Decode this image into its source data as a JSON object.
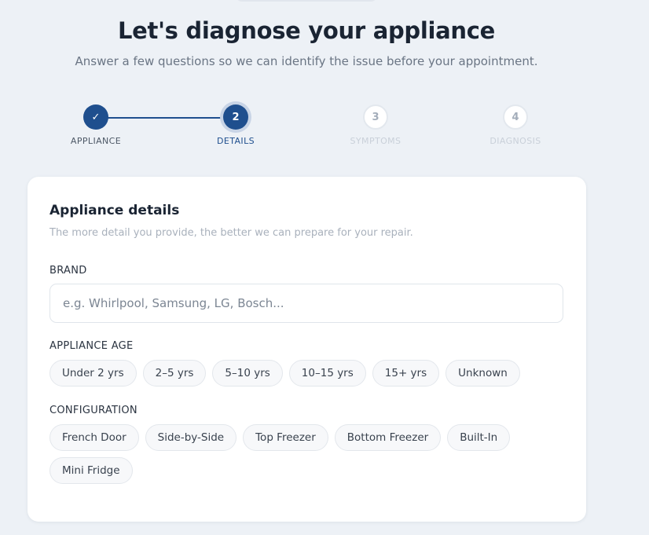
{
  "header": {
    "title": "Let's diagnose your appliance",
    "subtitle": "Answer a few questions so we can identify the issue before your appointment."
  },
  "stepper": {
    "steps": [
      {
        "number": "✓",
        "label": "APPLIANCE",
        "state": "done"
      },
      {
        "number": "2",
        "label": "DETAILS",
        "state": "current"
      },
      {
        "number": "3",
        "label": "SYMPTOMS",
        "state": "upcoming"
      },
      {
        "number": "4",
        "label": "DIAGNOSIS",
        "state": "upcoming"
      }
    ]
  },
  "card": {
    "title": "Appliance details",
    "description": "The more detail you provide, the better we can prepare for your repair.",
    "brand": {
      "label": "BRAND",
      "placeholder": "e.g. Whirlpool, Samsung, LG, Bosch...",
      "value": ""
    },
    "age": {
      "label": "APPLIANCE AGE",
      "options": [
        "Under 2 yrs",
        "2–5 yrs",
        "5–10 yrs",
        "10–15 yrs",
        "15+ yrs",
        "Unknown"
      ]
    },
    "configuration": {
      "label": "CONFIGURATION",
      "options": [
        "French Door",
        "Side-by-Side",
        "Top Freezer",
        "Bottom Freezer",
        "Built-In",
        "Mini Fridge"
      ]
    }
  },
  "colors": {
    "accent": "#1f4f8e",
    "background": "#edf1f6",
    "card": "#ffffff"
  }
}
